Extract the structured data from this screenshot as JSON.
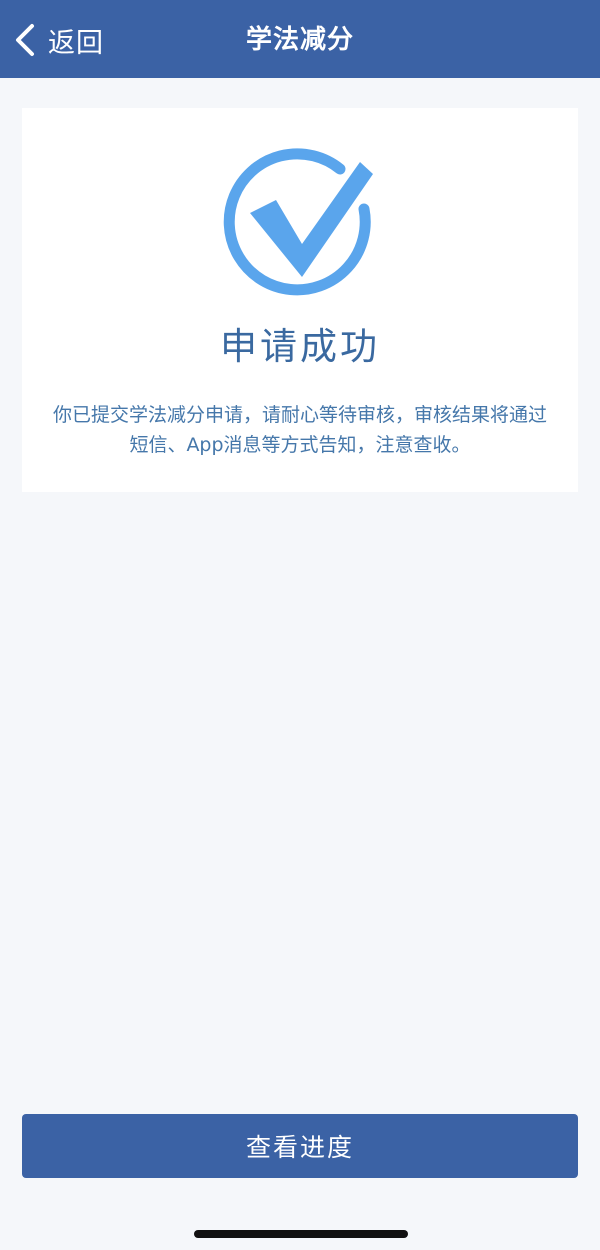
{
  "navbar": {
    "back_label": "返回",
    "title": "学法减分",
    "back_icon": "chevron-left-icon"
  },
  "result": {
    "icon": "check-circle-icon",
    "title": "申请成功",
    "description": "你已提交学法减分申请，请耐心等待审核，审核结果将通过短信、App消息等方式告知，注意查收。"
  },
  "footer": {
    "button_label": "查看进度"
  },
  "colors": {
    "primary": "#3b62a5",
    "check": "#5aa5ec",
    "title_text": "#3a69a0",
    "description_text": "#4577aa",
    "page_background": "#f5f7fa"
  }
}
